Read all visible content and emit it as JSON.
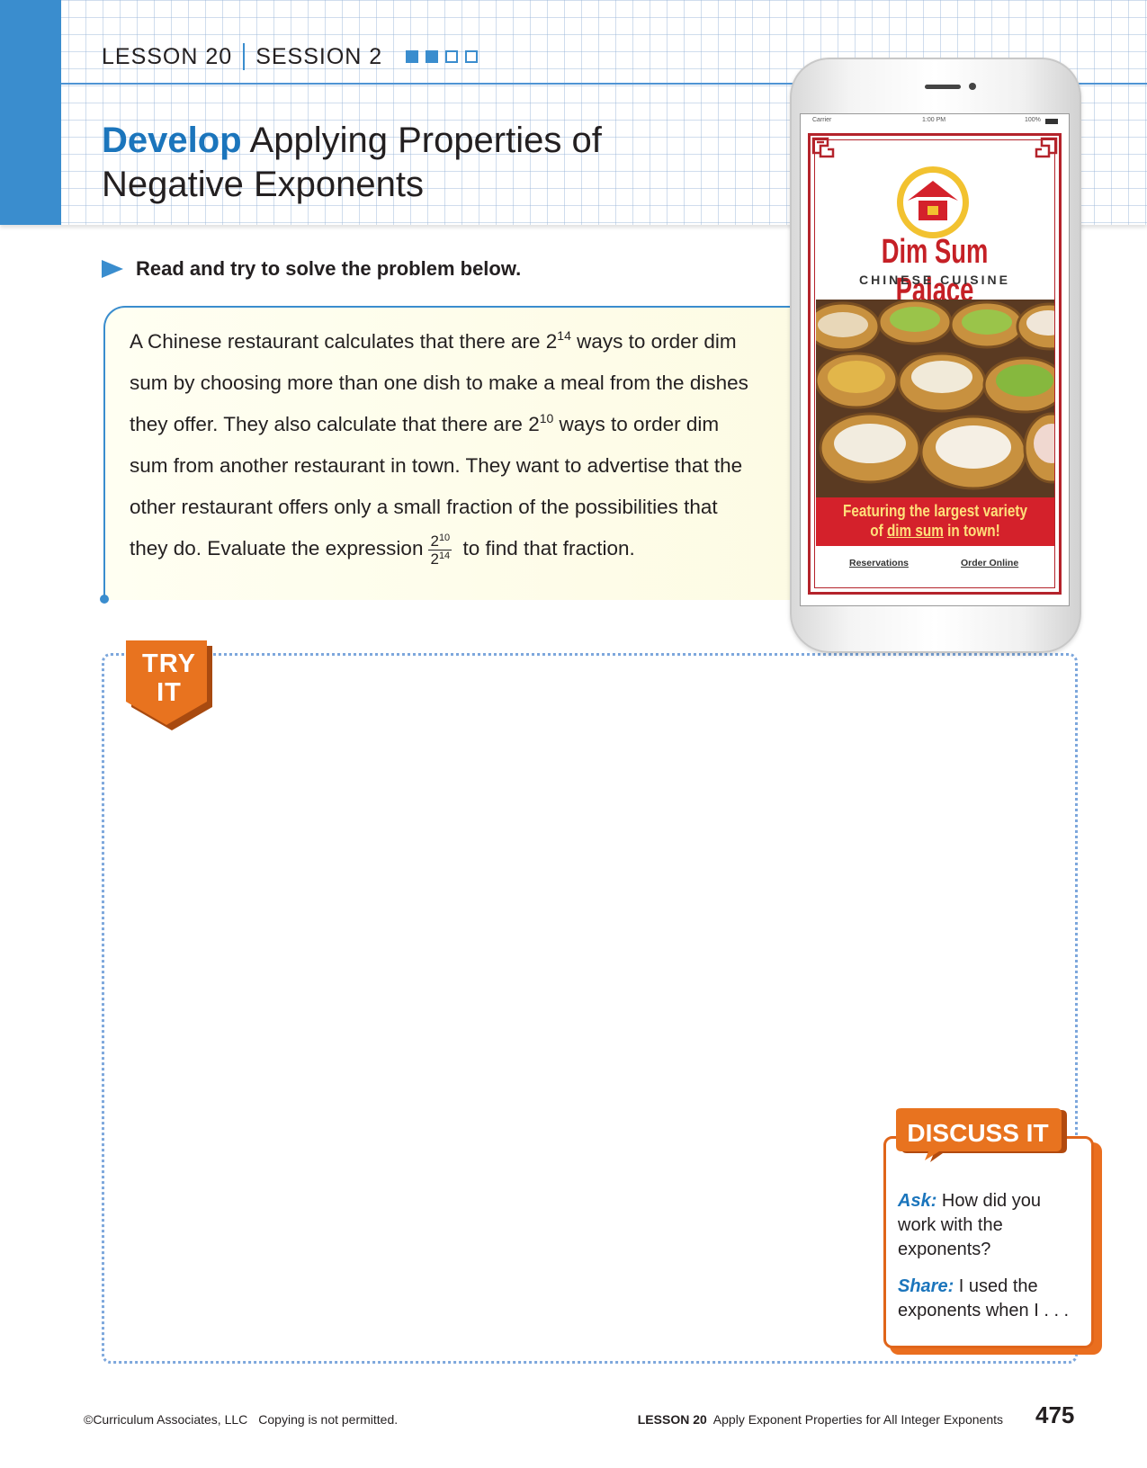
{
  "header": {
    "lesson": "LESSON 20",
    "session": "SESSION 2",
    "progress": [
      true,
      true,
      false,
      false
    ],
    "title_strong": "Develop",
    "title_rest_line1": "Applying Properties of",
    "title_rest_line2": "Negative Exponents"
  },
  "instruction": "Read and try to solve the problem below.",
  "problem": {
    "p1": "A Chinese restaurant calculates that there are 2",
    "sup1": "14",
    "p2": " ways to order dim sum by choosing more than one dish to make a meal from the dishes they offer. They also calculate that there are 2",
    "sup2": "10",
    "p3": " ways to order dim sum from another restaurant in town. They want to advertise that the other restaurant offers only a small fraction of the possibilities that they do. Evaluate the expression",
    "frac_num_base": "2",
    "frac_num_exp": "10",
    "frac_den_base": "2",
    "frac_den_exp": "14",
    "p4": " to find that fraction."
  },
  "try_it": {
    "line1": "TRY",
    "line2": "IT"
  },
  "phone": {
    "carrier": "Carrier",
    "time": "1:00 PM",
    "battery": "100%",
    "brand": "Dim Sum Palace",
    "subtitle": "CHINESE CUISINE",
    "banner_line1": "Featuring the largest variety",
    "banner_of": "of ",
    "banner_dimsum": "dim sum",
    "banner_intown": " in town!",
    "btn_reservations": "Reservations",
    "btn_order": "Order Online"
  },
  "discuss": {
    "title": "DISCUSS IT",
    "ask_label": "Ask:",
    "ask_text": " How did you work with the exponents?",
    "share_label": "Share:",
    "share_text": " I used the exponents when I . . ."
  },
  "footer": {
    "copyright": "©Curriculum Associates, LLC",
    "notice": "Copying is not permitted.",
    "lesson": "LESSON 20",
    "lesson_title": "Apply Exponent Properties for All Integer Exponents",
    "page": "475"
  },
  "colors": {
    "accent_blue": "#3a8dce",
    "accent_orange": "#e0651a",
    "brand_red": "#c52026"
  }
}
